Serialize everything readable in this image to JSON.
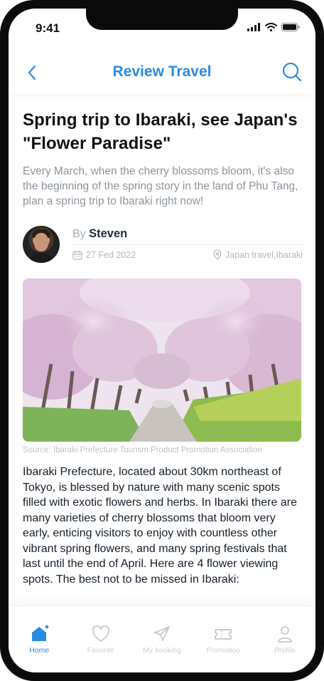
{
  "status": {
    "time": "9:41"
  },
  "header": {
    "title": "Review Travel"
  },
  "article": {
    "title": "Spring trip to Ibaraki, see Japan's \"Flower Paradise\"",
    "summary": "Every March, when the cherry blossoms bloom, it's also the beginning of the spring story in the land of Phu Tang, plan a spring trip to Ibaraki right now!",
    "by_prefix": "By",
    "author": "Steven",
    "date": "27 Fed 2022",
    "tags": "Japan travel,Ibaraki",
    "photo_caption": "Source: Ibaraki Prefecture Tourism Product Promotion Association",
    "body": "Ibaraki Prefecture, located about 30km northeast of Tokyo, is blessed by nature with many scenic spots filled with exotic flowers and herbs. In Ibaraki there are many varieties of cherry blossoms that bloom very early, enticing visitors to enjoy with countless other vibrant spring flowers, and many spring festivals that last until the end of April. Here are 4 flower viewing spots. The best not to be missed in Ibaraki:"
  },
  "tabbar": {
    "items": [
      {
        "label": "Home",
        "icon": "home-icon",
        "active": true
      },
      {
        "label": "Favorite",
        "icon": "heart-icon",
        "active": false
      },
      {
        "label": "My booking",
        "icon": "paper-plane-icon",
        "active": false
      },
      {
        "label": "Promotion",
        "icon": "ticket-icon",
        "active": false
      },
      {
        "label": "Profile",
        "icon": "person-icon",
        "active": false
      }
    ]
  },
  "colors": {
    "accent": "#2a8ce0",
    "inactive": "#c9ced3",
    "text": "#15202b",
    "muted": "#8d959e"
  }
}
